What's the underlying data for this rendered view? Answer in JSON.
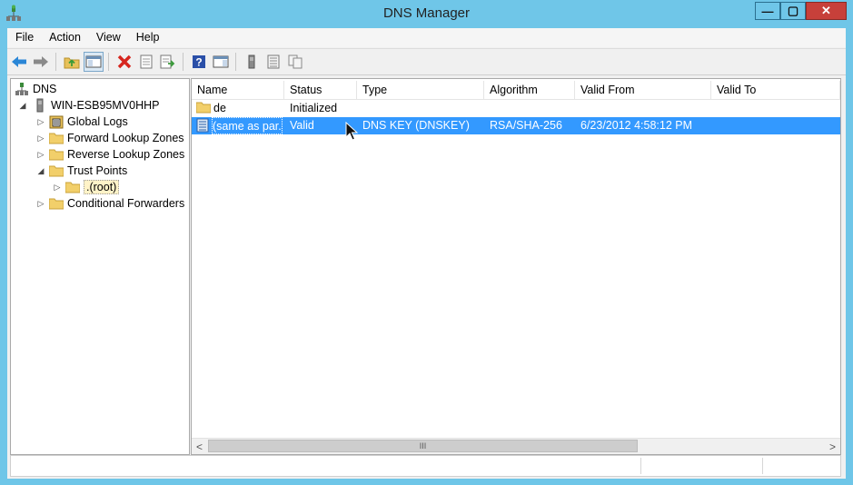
{
  "window": {
    "title": "DNS Manager",
    "accent": "#6fc6e8",
    "close_color": "#c7403a"
  },
  "controls": {
    "min": "—",
    "max": "▢",
    "close": "✕"
  },
  "menu": [
    "File",
    "Action",
    "View",
    "Help"
  ],
  "toolbar_icons": [
    "back-arrow-icon",
    "forward-arrow-icon",
    "up-folder-icon",
    "show-hide-tree-icon",
    "delete-icon",
    "properties-icon",
    "export-list-icon",
    "help-icon",
    "action-pane-icon",
    "server-icon",
    "list-icon",
    "copy-icon"
  ],
  "tree": {
    "items": [
      {
        "label": "DNS",
        "icon": "dns-icon"
      },
      {
        "label": "WIN-ESB95MV0HHP",
        "icon": "server-icon"
      },
      {
        "label": "Global Logs",
        "icon": "log-icon"
      },
      {
        "label": "Forward Lookup Zones",
        "icon": "folder-icon"
      },
      {
        "label": "Reverse Lookup Zones",
        "icon": "folder-icon"
      },
      {
        "label": "Trust Points",
        "icon": "folder-icon"
      },
      {
        "label": ".(root)",
        "icon": "folder-icon"
      },
      {
        "label": "Conditional Forwarders",
        "icon": "folder-icon"
      }
    ]
  },
  "list": {
    "columns": [
      "Name",
      "Status",
      "Type",
      "Algorithm",
      "Valid From",
      "Valid To"
    ],
    "rows": [
      {
        "name": "de",
        "status": "Initialized",
        "type": "",
        "algorithm": "",
        "valid_from": "",
        "valid_to": "",
        "icon": "folder-icon"
      },
      {
        "name": "(same as par...",
        "status": "Valid",
        "type": "DNS KEY (DNSKEY)",
        "algorithm": "RSA/SHA-256",
        "valid_from": "6/23/2012 4:58:12 PM",
        "valid_to": "",
        "icon": "record-icon"
      }
    ]
  },
  "scroll": {
    "left": "<",
    "right": ">",
    "thumb": "III"
  },
  "selection_color": "#3399ff"
}
